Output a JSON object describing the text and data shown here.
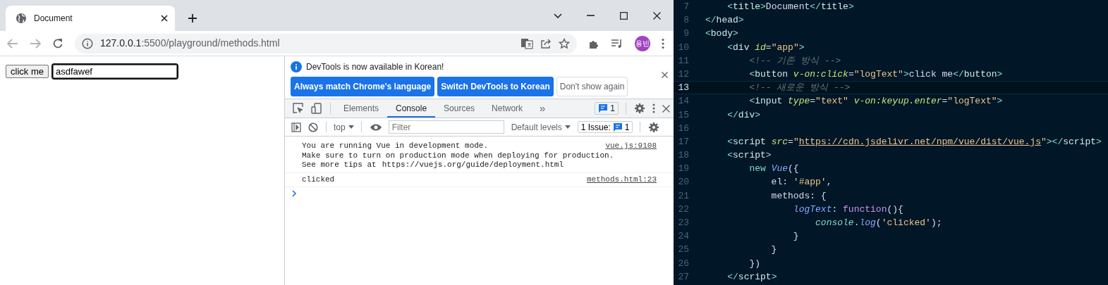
{
  "browser": {
    "tab": {
      "title": "Document"
    },
    "address": {
      "host": "127.0.0.1",
      "path": ":5500/playground/methods.html"
    },
    "profile": "용빈"
  },
  "page": {
    "button": "click me",
    "input": {
      "value": "asdfawef",
      "focused": true
    }
  },
  "devtools": {
    "infobar": {
      "message": "DevTools is now available in Korean!",
      "buttons": [
        {
          "label": "Always match Chrome's language",
          "kind": "primary"
        },
        {
          "label": "Switch DevTools to Korean",
          "kind": "primary"
        },
        {
          "label": "Don't show again",
          "kind": "secondary"
        }
      ]
    },
    "tabs": [
      {
        "label": "Elements",
        "selected": false
      },
      {
        "label": "Console",
        "selected": true
      },
      {
        "label": "Sources",
        "selected": false
      },
      {
        "label": "Network",
        "selected": false
      }
    ],
    "overflow": "»",
    "issues_badge": "1",
    "toolbar": {
      "context": "top",
      "filter": {
        "placeholder": "Filter"
      },
      "levels": "Default levels",
      "issues_label": "1 Issue:",
      "issues_count": "1"
    },
    "messages": [
      {
        "lines": [
          "You are running Vue in development mode.",
          "Make sure to turn on production mode when deploying for production.",
          "See more tips at"
        ],
        "link": "https://vuejs.org/guide/deployment.html",
        "source": "vue.js:9108"
      },
      {
        "lines": [
          "clicked"
        ],
        "source": "methods.html:23"
      }
    ]
  },
  "editor": {
    "lines": [
      {
        "number": "7",
        "current": false,
        "code": "    <title>Document</title>"
      },
      {
        "number": "8",
        "current": false,
        "code": "</head>"
      },
      {
        "number": "9",
        "current": false,
        "code": "<body>"
      },
      {
        "number": "10",
        "current": false,
        "code": "    <div id=\"app\">"
      },
      {
        "number": "11",
        "current": false,
        "code": "        <!-- 기존 방식 -->"
      },
      {
        "number": "12",
        "current": false,
        "code": "        <button v-on:click=\"logText\">click me</button>"
      },
      {
        "number": "13",
        "current": true,
        "code": "        <!-- 새로운 방식 -->"
      },
      {
        "number": "14",
        "current": false,
        "code": "        <input type=\"text\" v-on:keyup.enter=\"logText\">"
      },
      {
        "number": "15",
        "current": false,
        "code": "    </div>"
      },
      {
        "number": "16",
        "current": false
      },
      {
        "number": "17",
        "current": false,
        "code": "    <script src=\"https://cdn.jsdelivr.net/npm/vue/dist/vue.js\"></script>"
      },
      {
        "number": "18",
        "current": false,
        "code": "    <script>"
      },
      {
        "number": "19",
        "current": false,
        "code": "        new Vue({"
      },
      {
        "number": "20",
        "current": false,
        "code": "            el: '#app',"
      },
      {
        "number": "21",
        "current": false,
        "code": "            methods: {"
      },
      {
        "number": "22",
        "current": false,
        "code": "                logText: function(){"
      },
      {
        "number": "23",
        "current": false,
        "code": "                    console.log('clicked');"
      },
      {
        "number": "24",
        "current": false,
        "code": "                }"
      },
      {
        "number": "25",
        "current": false,
        "code": "            }"
      },
      {
        "number": "26",
        "current": false,
        "code": "        })"
      },
      {
        "number": "27",
        "current": false,
        "code": "    </script>"
      }
    ]
  }
}
